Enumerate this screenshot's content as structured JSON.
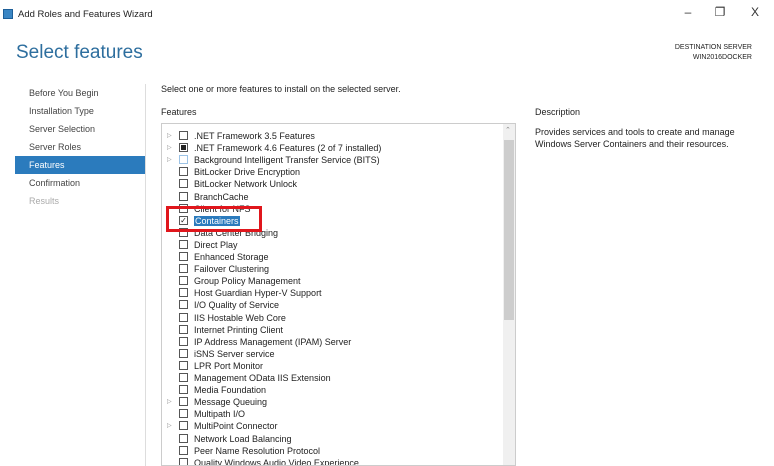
{
  "window": {
    "title": "Add Roles and Features Wizard",
    "minimize": "–",
    "restore": "❐",
    "close": "X"
  },
  "header": {
    "title": "Select features",
    "dest_label": "DESTINATION SERVER",
    "dest_server": "WIN2016DOCKER"
  },
  "nav": [
    {
      "label": "Before You Begin",
      "state": "normal"
    },
    {
      "label": "Installation Type",
      "state": "normal"
    },
    {
      "label": "Server Selection",
      "state": "normal"
    },
    {
      "label": "Server Roles",
      "state": "normal"
    },
    {
      "label": "Features",
      "state": "active"
    },
    {
      "label": "Confirmation",
      "state": "normal"
    },
    {
      "label": "Results",
      "state": "disabled"
    }
  ],
  "main": {
    "intro": "Select one or more features to install on the selected server.",
    "features_label": "Features",
    "description_label": "Description",
    "description": "Provides services and tools to create and manage Windows Server Containers and their resources."
  },
  "features": [
    {
      "label": ".NET Framework 3.5 Features",
      "expand": true,
      "state": "unchecked"
    },
    {
      "label": ".NET Framework 4.6 Features (2 of 7 installed)",
      "expand": true,
      "state": "partial"
    },
    {
      "label": "Background Intelligent Transfer Service (BITS)",
      "expand": true,
      "state": "light"
    },
    {
      "label": "BitLocker Drive Encryption",
      "state": "unchecked"
    },
    {
      "label": "BitLocker Network Unlock",
      "state": "unchecked"
    },
    {
      "label": "BranchCache",
      "state": "unchecked"
    },
    {
      "label": "Client for NFS",
      "state": "unchecked"
    },
    {
      "label": "Containers",
      "state": "checked",
      "selected": true
    },
    {
      "label": "Data Center Bridging",
      "state": "unchecked"
    },
    {
      "label": "Direct Play",
      "state": "unchecked"
    },
    {
      "label": "Enhanced Storage",
      "state": "unchecked"
    },
    {
      "label": "Failover Clustering",
      "state": "unchecked"
    },
    {
      "label": "Group Policy Management",
      "state": "unchecked"
    },
    {
      "label": "Host Guardian Hyper-V Support",
      "state": "unchecked"
    },
    {
      "label": "I/O Quality of Service",
      "state": "unchecked"
    },
    {
      "label": "IIS Hostable Web Core",
      "state": "unchecked"
    },
    {
      "label": "Internet Printing Client",
      "state": "unchecked"
    },
    {
      "label": "IP Address Management (IPAM) Server",
      "state": "unchecked"
    },
    {
      "label": "iSNS Server service",
      "state": "unchecked"
    },
    {
      "label": "LPR Port Monitor",
      "state": "unchecked"
    },
    {
      "label": "Management OData IIS Extension",
      "state": "unchecked"
    },
    {
      "label": "Media Foundation",
      "state": "unchecked"
    },
    {
      "label": "Message Queuing",
      "expand": true,
      "state": "unchecked"
    },
    {
      "label": "Multipath I/O",
      "state": "unchecked"
    },
    {
      "label": "MultiPoint Connector",
      "expand": true,
      "state": "unchecked"
    },
    {
      "label": "Network Load Balancing",
      "state": "unchecked"
    },
    {
      "label": "Peer Name Resolution Protocol",
      "state": "unchecked"
    },
    {
      "label": "Quality Windows Audio Video Experience",
      "state": "unchecked"
    }
  ],
  "colors": {
    "accent": "#2b7bbd",
    "highlight": "#e0161c",
    "title": "#2d6e9e"
  }
}
